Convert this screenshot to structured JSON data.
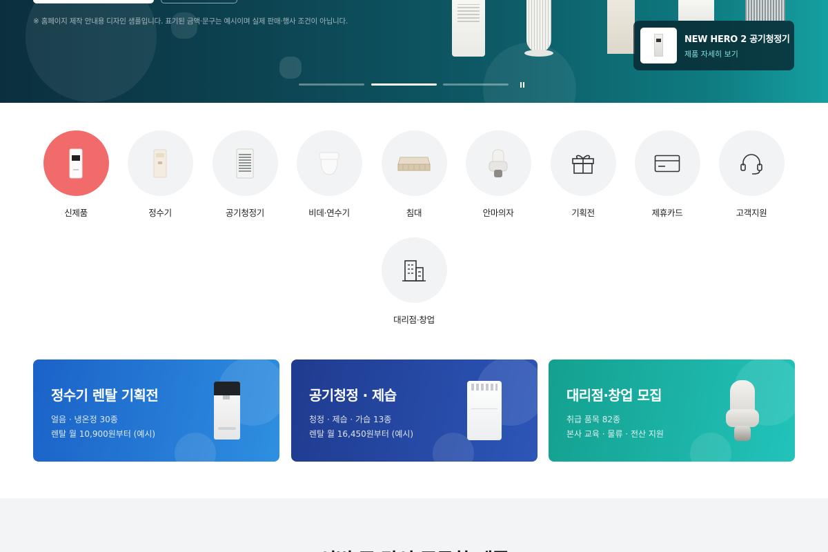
{
  "hero": {
    "note": "※ 홈페이지 제작 안내용 디자인 샘플입니다. 표기된 금액·문구는 예시이며 실제 판매·행사 조건이 아닙니다.",
    "card_title": "NEW HERO 2 공기청정기",
    "card_link": "제품 자세히 보기",
    "slides_total": 3,
    "active_slide": 2
  },
  "categories": [
    {
      "label": "신제품",
      "icon": "new-product-icon",
      "highlight": true
    },
    {
      "label": "정수기",
      "icon": "water-purifier-icon"
    },
    {
      "label": "공기청정기",
      "icon": "air-purifier-icon"
    },
    {
      "label": "비데·연수기",
      "icon": "bidet-icon"
    },
    {
      "label": "침대",
      "icon": "mattress-icon"
    },
    {
      "label": "안마의자",
      "icon": "massage-chair-icon"
    },
    {
      "label": "기획전",
      "icon": "gift-icon"
    },
    {
      "label": "제휴카드",
      "icon": "card-icon"
    },
    {
      "label": "고객지원",
      "icon": "headset-icon"
    },
    {
      "label": "대리점·창업",
      "icon": "building-icon"
    }
  ],
  "promos": [
    {
      "title": "정수기 렌탈 기획전",
      "line1": "얼음 · 냉온정 30종",
      "line2": "렌탈 월 10,900원부터 (예시)"
    },
    {
      "title": "공기청정 · 제습",
      "line1": "청정 · 제습 · 가습 13종",
      "line2": "렌탈 월 16,450원부터 (예시)"
    },
    {
      "title": "대리점·창업 모집",
      "line1": "취급 품목 82종",
      "line2": "본사 교육 · 물류 · 전산 지원"
    }
  ],
  "lower": {
    "title": "이번 주 많이 주문한 제품"
  },
  "colors": {
    "highlight": "#f26b6b",
    "category_bg": "#f1f3f5",
    "hero_link": "#7ee0e0"
  }
}
